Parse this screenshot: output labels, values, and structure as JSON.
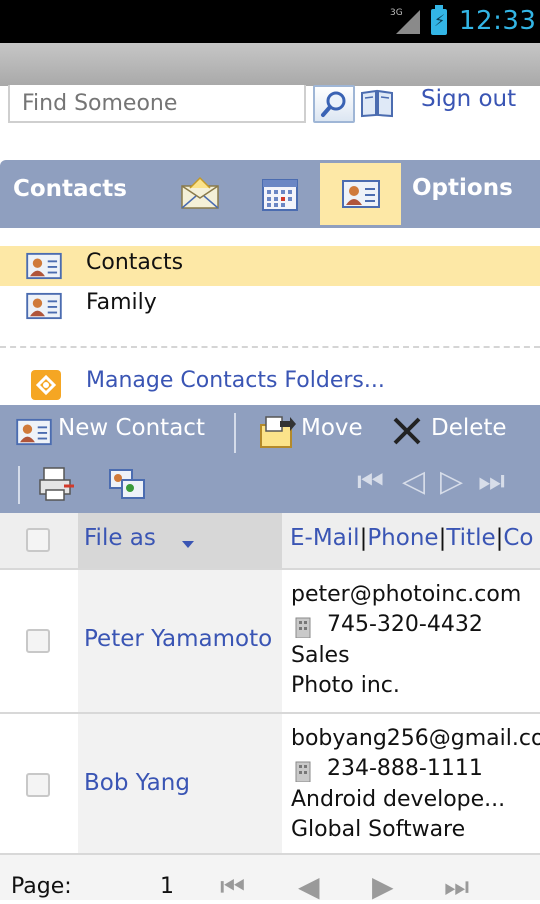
{
  "status_bar": {
    "network": "3G",
    "time": "12:33"
  },
  "search": {
    "placeholder": "Find Someone",
    "sign_out": "Sign out"
  },
  "nav": {
    "contacts_label": "Contacts",
    "options_label": "Options"
  },
  "folders": [
    {
      "label": "Contacts",
      "selected": true
    },
    {
      "label": "Family",
      "selected": false
    }
  ],
  "manage_folders": "Manage Contacts Folders...",
  "toolbar": {
    "new_contact": "New Contact",
    "move": "Move",
    "delete": "Delete"
  },
  "table": {
    "columns": {
      "file_as": "File as",
      "email": "E-Mail",
      "phone": "Phone",
      "title": "Title",
      "company_partial": "Co",
      "sep": "|"
    },
    "rows": [
      {
        "name": "Peter Yamamoto",
        "email": "peter@photoinc.com",
        "phone": "745-320-4432",
        "title": "Sales",
        "company": "Photo inc."
      },
      {
        "name": "Bob Yang",
        "email": "bobyang256@gmail.co",
        "phone": "234-888-1111",
        "title": "Android develope...",
        "company": "Global Software"
      }
    ]
  },
  "footer": {
    "page_label": "Page:",
    "page_number": "1"
  },
  "colors": {
    "accent_bar": "#8f9fbf",
    "selected": "#fde8a6",
    "link": "#3a55b4",
    "clock": "#33b5e5"
  },
  "icons": [
    "search-icon",
    "address-book-icon",
    "mail-icon",
    "calendar-icon",
    "contact-card-icon",
    "manage-folders-icon",
    "move-icon",
    "delete-icon",
    "print-icon",
    "categorize-icon",
    "first-page-icon",
    "prev-page-icon",
    "next-page-icon",
    "last-page-icon",
    "building-icon"
  ]
}
